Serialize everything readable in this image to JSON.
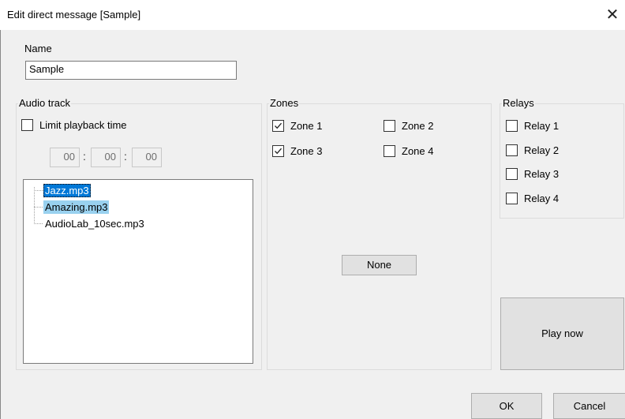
{
  "window": {
    "title": "Edit direct message [Sample]",
    "close_glyph": "✕"
  },
  "name_section": {
    "label": "Name",
    "value": "Sample"
  },
  "audio_track": {
    "legend": "Audio track",
    "limit_label": "Limit playback time",
    "limit_checked": false,
    "time": {
      "hours": "00",
      "minutes": "00",
      "seconds": "00",
      "separator": ":"
    },
    "files": [
      {
        "label": "Jazz.mp3",
        "state": "selected"
      },
      {
        "label": "Amazing.mp3",
        "state": "highlighted"
      },
      {
        "label": "AudioLab_10sec.mp3",
        "state": "normal"
      }
    ]
  },
  "zones": {
    "legend": "Zones",
    "items": [
      {
        "label": "Zone 1",
        "checked": true
      },
      {
        "label": "Zone 2",
        "checked": false
      },
      {
        "label": "Zone 3",
        "checked": true
      },
      {
        "label": "Zone 4",
        "checked": false
      }
    ],
    "none_button": "None"
  },
  "relays": {
    "legend": "Relays",
    "items": [
      {
        "label": "Relay 1",
        "checked": false
      },
      {
        "label": "Relay 2",
        "checked": false
      },
      {
        "label": "Relay 3",
        "checked": false
      },
      {
        "label": "Relay 4",
        "checked": false
      }
    ]
  },
  "buttons": {
    "play_now": "Play now",
    "ok": "OK",
    "cancel": "Cancel"
  },
  "colors": {
    "selected_bg": "#0078d7",
    "highlight_bg": "#99d1ef",
    "dialog_bg": "#f0f0f0"
  }
}
